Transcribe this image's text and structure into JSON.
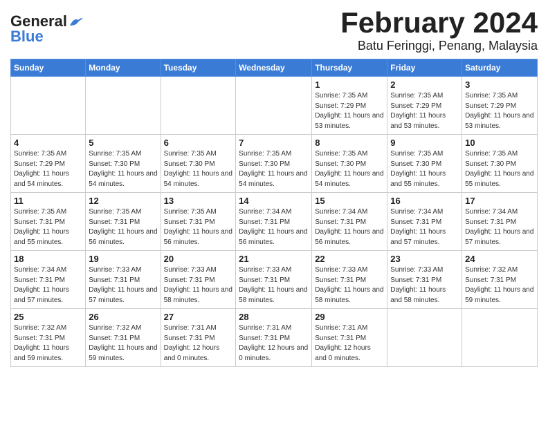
{
  "logo": {
    "line1": "General",
    "line2": "Blue"
  },
  "title": "February 2024",
  "subtitle": "Batu Feringgi, Penang, Malaysia",
  "days_of_week": [
    "Sunday",
    "Monday",
    "Tuesday",
    "Wednesday",
    "Thursday",
    "Friday",
    "Saturday"
  ],
  "weeks": [
    [
      {
        "day": "",
        "info": ""
      },
      {
        "day": "",
        "info": ""
      },
      {
        "day": "",
        "info": ""
      },
      {
        "day": "",
        "info": ""
      },
      {
        "day": "1",
        "info": "Sunrise: 7:35 AM\nSunset: 7:29 PM\nDaylight: 11 hours\nand 53 minutes."
      },
      {
        "day": "2",
        "info": "Sunrise: 7:35 AM\nSunset: 7:29 PM\nDaylight: 11 hours\nand 53 minutes."
      },
      {
        "day": "3",
        "info": "Sunrise: 7:35 AM\nSunset: 7:29 PM\nDaylight: 11 hours\nand 53 minutes."
      }
    ],
    [
      {
        "day": "4",
        "info": "Sunrise: 7:35 AM\nSunset: 7:29 PM\nDaylight: 11 hours\nand 54 minutes."
      },
      {
        "day": "5",
        "info": "Sunrise: 7:35 AM\nSunset: 7:30 PM\nDaylight: 11 hours\nand 54 minutes."
      },
      {
        "day": "6",
        "info": "Sunrise: 7:35 AM\nSunset: 7:30 PM\nDaylight: 11 hours\nand 54 minutes."
      },
      {
        "day": "7",
        "info": "Sunrise: 7:35 AM\nSunset: 7:30 PM\nDaylight: 11 hours\nand 54 minutes."
      },
      {
        "day": "8",
        "info": "Sunrise: 7:35 AM\nSunset: 7:30 PM\nDaylight: 11 hours\nand 54 minutes."
      },
      {
        "day": "9",
        "info": "Sunrise: 7:35 AM\nSunset: 7:30 PM\nDaylight: 11 hours\nand 55 minutes."
      },
      {
        "day": "10",
        "info": "Sunrise: 7:35 AM\nSunset: 7:30 PM\nDaylight: 11 hours\nand 55 minutes."
      }
    ],
    [
      {
        "day": "11",
        "info": "Sunrise: 7:35 AM\nSunset: 7:31 PM\nDaylight: 11 hours\nand 55 minutes."
      },
      {
        "day": "12",
        "info": "Sunrise: 7:35 AM\nSunset: 7:31 PM\nDaylight: 11 hours\nand 56 minutes."
      },
      {
        "day": "13",
        "info": "Sunrise: 7:35 AM\nSunset: 7:31 PM\nDaylight: 11 hours\nand 56 minutes."
      },
      {
        "day": "14",
        "info": "Sunrise: 7:34 AM\nSunset: 7:31 PM\nDaylight: 11 hours\nand 56 minutes."
      },
      {
        "day": "15",
        "info": "Sunrise: 7:34 AM\nSunset: 7:31 PM\nDaylight: 11 hours\nand 56 minutes."
      },
      {
        "day": "16",
        "info": "Sunrise: 7:34 AM\nSunset: 7:31 PM\nDaylight: 11 hours\nand 57 minutes."
      },
      {
        "day": "17",
        "info": "Sunrise: 7:34 AM\nSunset: 7:31 PM\nDaylight: 11 hours\nand 57 minutes."
      }
    ],
    [
      {
        "day": "18",
        "info": "Sunrise: 7:34 AM\nSunset: 7:31 PM\nDaylight: 11 hours\nand 57 minutes."
      },
      {
        "day": "19",
        "info": "Sunrise: 7:33 AM\nSunset: 7:31 PM\nDaylight: 11 hours\nand 57 minutes."
      },
      {
        "day": "20",
        "info": "Sunrise: 7:33 AM\nSunset: 7:31 PM\nDaylight: 11 hours\nand 58 minutes."
      },
      {
        "day": "21",
        "info": "Sunrise: 7:33 AM\nSunset: 7:31 PM\nDaylight: 11 hours\nand 58 minutes."
      },
      {
        "day": "22",
        "info": "Sunrise: 7:33 AM\nSunset: 7:31 PM\nDaylight: 11 hours\nand 58 minutes."
      },
      {
        "day": "23",
        "info": "Sunrise: 7:33 AM\nSunset: 7:31 PM\nDaylight: 11 hours\nand 58 minutes."
      },
      {
        "day": "24",
        "info": "Sunrise: 7:32 AM\nSunset: 7:31 PM\nDaylight: 11 hours\nand 59 minutes."
      }
    ],
    [
      {
        "day": "25",
        "info": "Sunrise: 7:32 AM\nSunset: 7:31 PM\nDaylight: 11 hours\nand 59 minutes."
      },
      {
        "day": "26",
        "info": "Sunrise: 7:32 AM\nSunset: 7:31 PM\nDaylight: 11 hours\nand 59 minutes."
      },
      {
        "day": "27",
        "info": "Sunrise: 7:31 AM\nSunset: 7:31 PM\nDaylight: 12 hours\nand 0 minutes."
      },
      {
        "day": "28",
        "info": "Sunrise: 7:31 AM\nSunset: 7:31 PM\nDaylight: 12 hours\nand 0 minutes."
      },
      {
        "day": "29",
        "info": "Sunrise: 7:31 AM\nSunset: 7:31 PM\nDaylight: 12 hours\nand 0 minutes."
      },
      {
        "day": "",
        "info": ""
      },
      {
        "day": "",
        "info": ""
      }
    ]
  ]
}
